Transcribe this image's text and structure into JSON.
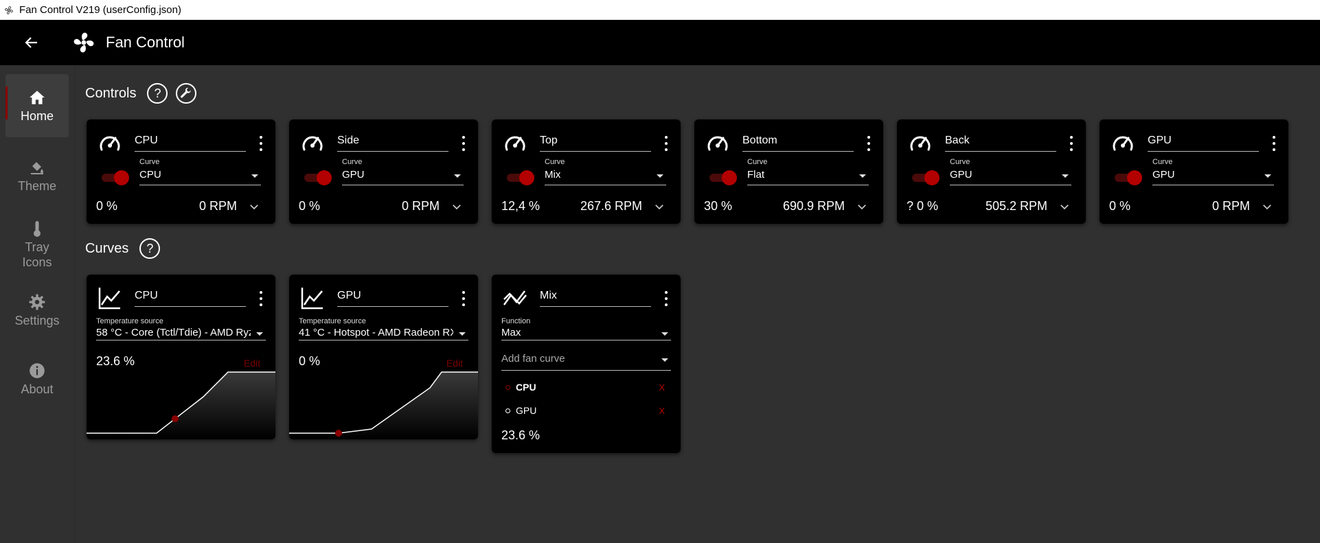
{
  "window": {
    "title": "Fan Control V219 (userConfig.json)"
  },
  "appbar": {
    "title": "Fan Control"
  },
  "sidebar": {
    "items": [
      {
        "label": "Home",
        "icon": "home-icon",
        "active": true
      },
      {
        "label": "Theme",
        "icon": "paint-bucket-icon"
      },
      {
        "label": "Tray Icons",
        "icon": "thermometer-icon"
      },
      {
        "label": "Settings",
        "icon": "gear-icon"
      },
      {
        "label": "About",
        "icon": "info-icon"
      }
    ]
  },
  "controls": {
    "title": "Controls",
    "curve_label": "Curve",
    "items": [
      {
        "name": "CPU",
        "curve": "CPU",
        "percent": "0 %",
        "rpm": "0 RPM"
      },
      {
        "name": "Side",
        "curve": "GPU",
        "percent": "0 %",
        "rpm": "0 RPM"
      },
      {
        "name": "Top",
        "curve": "Mix",
        "percent": "12,4 %",
        "rpm": "267.6 RPM"
      },
      {
        "name": "Bottom",
        "curve": "Flat",
        "percent": "30 %",
        "rpm": "690.9 RPM"
      },
      {
        "name": "Back",
        "curve": "GPU",
        "percent": "? 0 %",
        "rpm": "505.2 RPM"
      },
      {
        "name": "GPU",
        "curve": "GPU",
        "percent": "0 %",
        "rpm": "0 RPM"
      }
    ]
  },
  "curves": {
    "title": "Curves",
    "temp_source_label": "Temperature source",
    "edit_label": "Edit",
    "cpu": {
      "name": "CPU",
      "source": "58 °C - Core (Tctl/Tdie) - AMD Ryz",
      "percent": "23.6 %"
    },
    "gpu": {
      "name": "GPU",
      "source": "41 °C - Hotspot - AMD Radeon RX",
      "percent": "0 %"
    },
    "mix": {
      "name": "Mix",
      "function_label": "Function",
      "function": "Max",
      "add_placeholder": "Add fan curve",
      "items": [
        {
          "name": "CPU",
          "bold": true
        },
        {
          "name": "GPU",
          "bold": false
        }
      ],
      "remove_label": "X",
      "percent": "23.6 %"
    }
  },
  "colors": {
    "accent": "#b30000",
    "background": "#303030",
    "card": "#000000"
  }
}
